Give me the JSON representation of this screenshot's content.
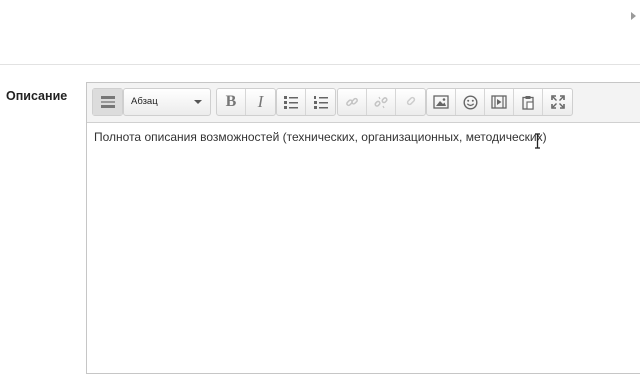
{
  "form": {
    "field_label": "Описание"
  },
  "editor": {
    "paragraph_select": {
      "selected": "Абзац"
    },
    "content_text": "Полнота описания возможностей (технических, организационных, методических)",
    "toolbar_buttons": [
      "toolbar-toggle-icon",
      "bold-icon",
      "italic-icon",
      "unordered-list-icon",
      "ordered-list-icon",
      "link-icon",
      "unlink-icon",
      "anchor-icon",
      "image-icon",
      "emoticon-icon",
      "media-icon",
      "paste-icon",
      "fullscreen-icon"
    ]
  }
}
